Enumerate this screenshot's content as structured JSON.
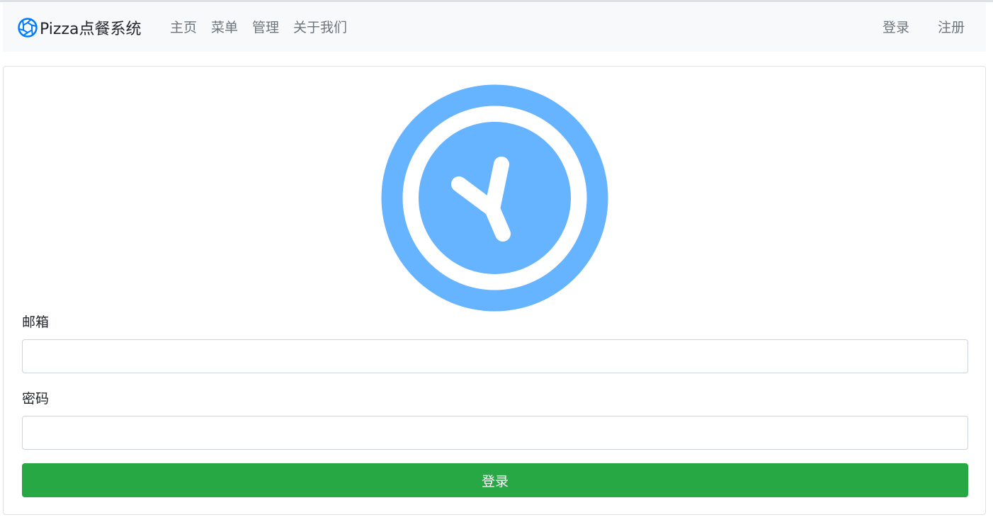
{
  "navbar": {
    "brand": "Pizza点餐系统",
    "brand_icon": "aperture-icon",
    "links": [
      "主页",
      "菜单",
      "管理",
      "关于我们"
    ],
    "right_links": [
      "登录",
      "注册"
    ]
  },
  "login_form": {
    "logo_icon": "clock-icon",
    "email_label": "邮箱",
    "email_value": "",
    "password_label": "密码",
    "password_value": "",
    "submit_label": "登录"
  },
  "colors": {
    "brand_icon": "#007bff",
    "logo": "#66b3ff",
    "submit": "#28a745",
    "navbar_bg": "#f8f9fa",
    "nav_link": "#6c757d"
  }
}
